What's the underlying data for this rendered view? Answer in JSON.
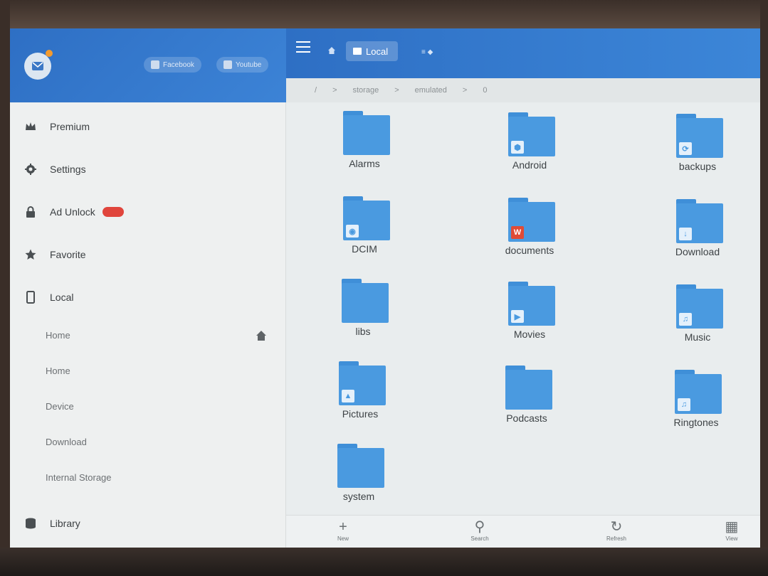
{
  "drawer": {
    "social": [
      {
        "label": "Facebook",
        "icon": "facebook-icon"
      },
      {
        "label": "Youtube",
        "icon": "youtube-icon"
      }
    ],
    "items": [
      {
        "label": "Premium",
        "icon": "crown-icon"
      },
      {
        "label": "Settings",
        "icon": "gear-icon"
      },
      {
        "label": "Ad Unlock",
        "icon": "lock-icon",
        "badge": true
      },
      {
        "label": "Favorite",
        "icon": "star-icon"
      },
      {
        "label": "Local",
        "icon": "phone-icon"
      }
    ],
    "local_children": [
      "Home",
      "Home",
      "Device",
      "Download",
      "Internal Storage"
    ],
    "library": {
      "label": "Library",
      "icon": "stack-icon"
    }
  },
  "topbar": {
    "tab_label": "Local"
  },
  "path": [
    "/",
    ">",
    "storage",
    ">",
    "emulated",
    ">",
    "0"
  ],
  "folders": [
    {
      "name": "Alarms",
      "badge": ""
    },
    {
      "name": "Android",
      "badge": "android"
    },
    {
      "name": "backups",
      "badge": "backup"
    },
    {
      "name": "DCIM",
      "badge": "camera"
    },
    {
      "name": "documents",
      "badge": "wps"
    },
    {
      "name": "Download",
      "badge": "download"
    },
    {
      "name": "libs",
      "badge": ""
    },
    {
      "name": "Movies",
      "badge": "play"
    },
    {
      "name": "Music",
      "badge": "note"
    },
    {
      "name": "Pictures",
      "badge": "picture"
    },
    {
      "name": "Podcasts",
      "badge": ""
    },
    {
      "name": "Ringtones",
      "badge": "note"
    },
    {
      "name": "system",
      "badge": ""
    }
  ],
  "bottombar": [
    {
      "label": "New",
      "glyph": "+",
      "icon": "plus-icon"
    },
    {
      "label": "Search",
      "glyph": "⚲",
      "icon": "search-icon"
    },
    {
      "label": "Refresh",
      "glyph": "↻",
      "icon": "refresh-icon"
    },
    {
      "label": "View",
      "glyph": "▦",
      "icon": "view-grid-icon"
    }
  ],
  "colors": {
    "accent": "#2e6fc4",
    "folder": "#4a9ae0",
    "badge_red": "#e0453c"
  }
}
